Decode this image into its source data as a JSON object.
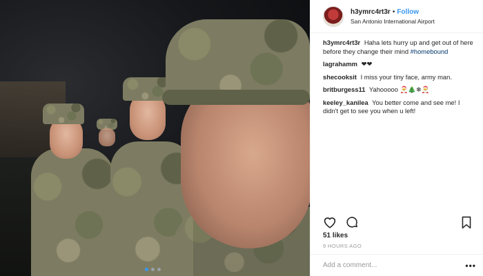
{
  "post": {
    "username": "h3ymrc4rt3r",
    "separator": "•",
    "follow_label": "Follow",
    "location": "San Antonio International Airport",
    "caption": {
      "user": "h3ymrc4rt3r",
      "text": "Haha lets hurry up and get out of here before they change their mind",
      "hashtag": "#homebound"
    }
  },
  "comments": [
    {
      "user": "lagrahamm",
      "text": "❤❤"
    },
    {
      "user": "shecooksit",
      "text": "I miss your tiny face, army man."
    },
    {
      "user": "britburgess11",
      "text": "Yahooooo 🎅🎄❄🎅"
    },
    {
      "user": "keeley_kanilea",
      "text": "You better come and see me! I didn't get to see you when u left!"
    }
  ],
  "actions": {
    "like_icon": "heart-icon",
    "comment_icon": "speech-bubble-icon",
    "save_icon": "bookmark-icon"
  },
  "likes_label": "51 likes",
  "timestamp": "9 HOURS AGO",
  "add_comment": {
    "placeholder": "Add a comment...",
    "more_label": "•••"
  },
  "carousel": {
    "count": 3,
    "active_index": 0
  },
  "colors": {
    "accent": "#3897f0",
    "text": "#262626",
    "muted": "#999999",
    "hashtag": "#003569"
  }
}
